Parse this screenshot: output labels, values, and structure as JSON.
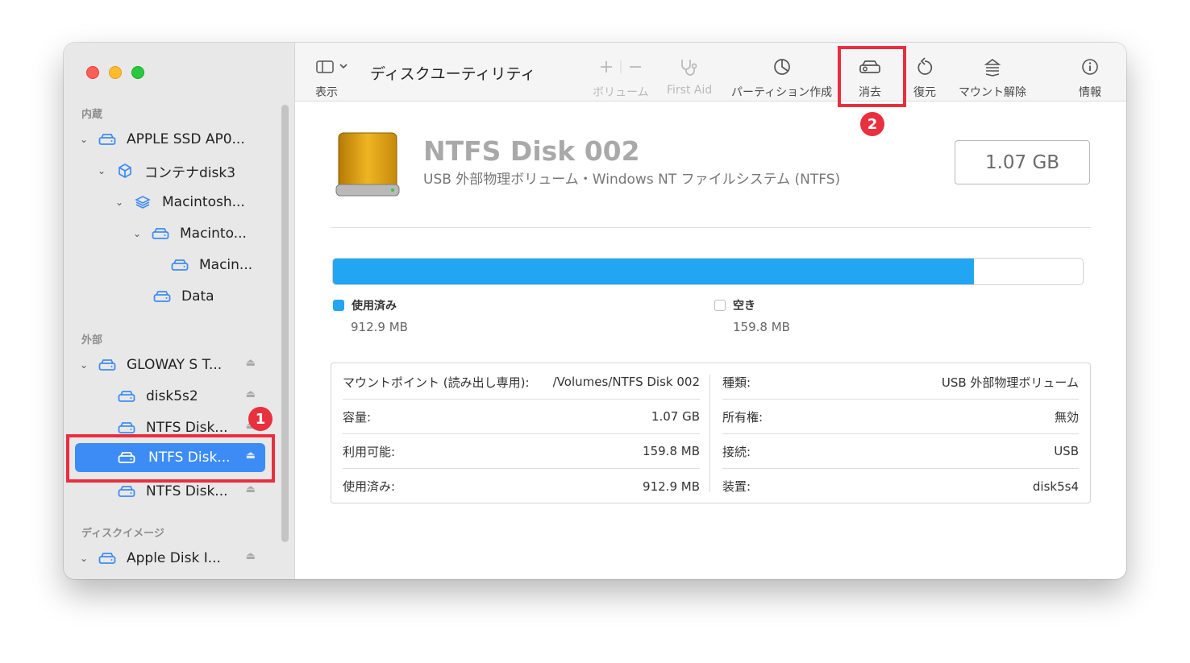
{
  "window": {
    "title": "ディスクユーティリティ"
  },
  "toolbar": {
    "view_label": "表示",
    "volume_label": "ボリューム",
    "firstaid_label": "First Aid",
    "partition_label": "パーティション作成",
    "erase_label": "消去",
    "restore_label": "復元",
    "unmount_label": "マウント解除",
    "info_label": "情報"
  },
  "sidebar": {
    "internal_label": "内蔵",
    "external_label": "外部",
    "diskimage_label": "ディスクイメージ",
    "internal_items": [
      {
        "label": "APPLE SSD AP0...",
        "icon": "drive-icon"
      },
      {
        "label": "コンテナdisk3",
        "icon": "container-icon"
      },
      {
        "label": "Macintosh...",
        "icon": "layers-icon"
      },
      {
        "label": "Macinto...",
        "icon": "drive-icon"
      },
      {
        "label": "Macin...",
        "icon": "drive-icon"
      },
      {
        "label": "Data",
        "icon": "drive-icon"
      }
    ],
    "external_items": [
      {
        "label": "GLOWAY S T...",
        "icon": "drive-icon"
      },
      {
        "label": "disk5s2",
        "icon": "drive-icon"
      },
      {
        "label": "NTFS Disk...",
        "icon": "drive-icon"
      },
      {
        "label": "NTFS Disk...",
        "icon": "drive-icon",
        "selected": true
      },
      {
        "label": "NTFS Disk...",
        "icon": "drive-icon"
      }
    ],
    "diskimage_items": [
      {
        "label": "Apple Disk I...",
        "icon": "drive-icon"
      }
    ]
  },
  "annotations": {
    "badge1": "1",
    "badge2": "2",
    "highlight_color": "#ea2e3e"
  },
  "disk": {
    "name": "NTFS Disk 002",
    "subtitle": "USB 外部物理ボリューム・Windows NT ファイルシステム (NTFS)",
    "capacity": "1.07 GB",
    "used_fraction": 0.855,
    "used_color": "#22a6f1",
    "used_label": "使用済み",
    "used_value": "912.9 MB",
    "free_label": "空き",
    "free_value": "159.8 MB"
  },
  "info": {
    "left": [
      {
        "key": "マウントポイント (読み出し専用):",
        "value": "/Volumes/NTFS Disk 002"
      },
      {
        "key": "容量:",
        "value": "1.07 GB"
      },
      {
        "key": "利用可能:",
        "value": "159.8 MB"
      },
      {
        "key": "使用済み:",
        "value": "912.9 MB"
      }
    ],
    "right": [
      {
        "key": "種類:",
        "value": "USB 外部物理ボリューム"
      },
      {
        "key": "所有権:",
        "value": "無効"
      },
      {
        "key": "接続:",
        "value": "USB"
      },
      {
        "key": "装置:",
        "value": "disk5s4"
      }
    ]
  }
}
